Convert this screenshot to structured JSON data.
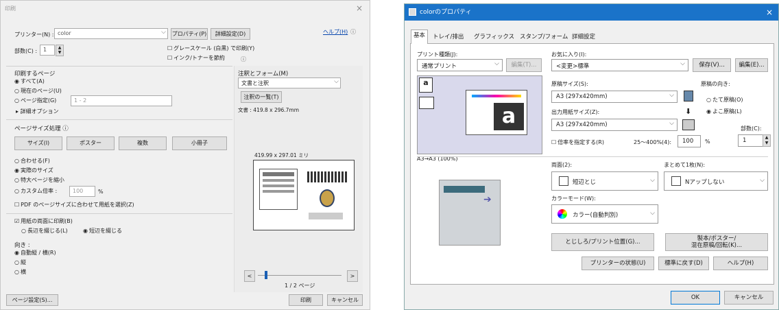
{
  "left": {
    "title": "印刷",
    "close": "×",
    "printer_label": "プリンター(N) :",
    "printer_value": "color",
    "properties": "プロパティ(P)",
    "advanced": "詳細設定(D)",
    "help": "ヘルプ(H)",
    "help_icon": "ⓘ",
    "copies_label": "部数(C) :",
    "copies_value": "1",
    "grayscale": "グレースケール (白黒) で印刷(Y)",
    "ink_save": "インク/トナーを節約",
    "info_icon": "ⓘ",
    "pages_title": "印刷するページ",
    "all": "すべて(A)",
    "current": "現在のページ(U)",
    "range": "ページ指定(G)",
    "range_ph": "1 - 2",
    "more": "▸ 詳細オプション",
    "comments_title": "注釈とフォーム(M)",
    "comments_value": "文書と注釈",
    "comments_list": "注釈の一覧(T)",
    "doc_size": "文書 : 419.8 x 296.7mm",
    "sizing_title": "ページサイズ処理 ⓘ",
    "tabs": [
      "サイズ(I)",
      "ポスター",
      "複数",
      "小冊子"
    ],
    "fit": "合わせる(F)",
    "actual": "実際のサイズ",
    "shrink": "特大ページを縮小",
    "custom": "カスタム倍率 :",
    "custom_val": "100",
    "pct": "%",
    "pdf_paper": "PDF のページサイズに合わせて用紙を選択(Z)",
    "duplex": "用紙の両面に印刷(B)",
    "long_edge": "長辺を綴じる(L)",
    "short_edge": "短辺を綴じる",
    "orient_title": "向き :",
    "auto": "自動縦 / 横(R)",
    "portrait": "縦",
    "landscape": "横",
    "preview_size": "419.99 x 297.01 ミリ",
    "page_count": "1 / 2 ページ",
    "prev": "<",
    "next": ">",
    "page_setup": "ページ設定(S)...",
    "print": "印刷",
    "cancel": "キャンセル"
  },
  "right": {
    "title": "colorのプロパティ",
    "close": "×",
    "tabs": [
      "基本",
      "トレイ/排出",
      "グラフィックス",
      "スタンプ/フォーム",
      "詳細設定"
    ],
    "print_type_label": "プリント種類(J):",
    "print_type": "通常プリント",
    "edit_t": "編集(T)...",
    "fav_label": "お気に入り(I):",
    "fav_value": "<変更>標準",
    "save": "保存(V)...",
    "edit_e": "編集(E)...",
    "orig_size_label": "原稿サイズ(S):",
    "orig_size": "A3 (297x420mm)",
    "out_size_label": "出力用紙サイズ(Z):",
    "out_size": "A3 (297x420mm)",
    "orient_label": "原稿の向き:",
    "portrait": "たて原稿(O)",
    "landscape": "よこ原稿(L)",
    "copies_label": "部数(C):",
    "copies": "1",
    "scale_chk": "倍率を指定する(R)",
    "scale_range": "25〜400%(4):",
    "scale_val": "100",
    "pct": "%",
    "preview_caption": "A3→A3 (100%)",
    "duplex_label": "両面(2):",
    "duplex": "短辺とじ",
    "nup_label": "まとめて1枚(N):",
    "nup": "Nアップしない",
    "color_label": "カラーモード(W):",
    "color": "カラー(自動判別)",
    "margin_btn": "とじしろ/プリント位置(G)...",
    "booklet_btn": "製本/ポスター/\n混在原稿/回転(K)...",
    "status_btn": "プリンターの状態(U)",
    "default_btn": "標準に戻す(D)",
    "help_btn": "ヘルプ(H)",
    "ok": "OK",
    "cancel": "キャンセル"
  }
}
